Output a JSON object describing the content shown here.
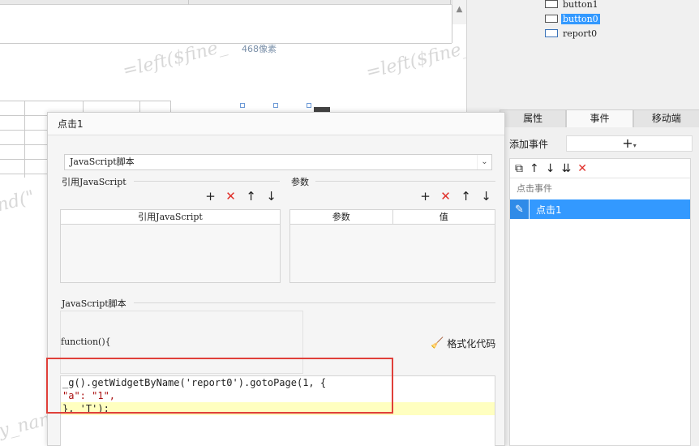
{
  "canvas": {
    "pixel_label": "468像素",
    "watermarks": [
      "=left($fine_",
      "=left($fine_",
      "nd(\"",
      "y_nan"
    ]
  },
  "widget_tree": {
    "items": [
      {
        "label": "button1",
        "selected": false
      },
      {
        "label": "button0",
        "selected": true
      },
      {
        "label": "report0",
        "selected": false
      }
    ]
  },
  "right_tabs": [
    {
      "label": "属性",
      "active": false
    },
    {
      "label": "事件",
      "active": true
    },
    {
      "label": "移动端",
      "active": false
    }
  ],
  "events": {
    "add_label": "添加事件",
    "add_plus": "+",
    "add_arrow": "▾",
    "tool_icons": [
      "⧉",
      "↑",
      "↓",
      "⇊",
      "✕"
    ],
    "group_label": "点击事件",
    "item_label": "点击1",
    "item_icon": "✎"
  },
  "dialog": {
    "title": "点击1",
    "type_value": "JavaScript脚本",
    "type_arrow": "⌄",
    "ref_js_label": "引用JavaScript",
    "ref_js_column": "引用JavaScript",
    "params_label": "参数",
    "params_columns": [
      "参数",
      "值"
    ],
    "tool_icons": [
      "+",
      "✕",
      "↑",
      "↓"
    ],
    "script_label": "JavaScript脚本",
    "function_signature": "function(){",
    "format_icon": "🧹",
    "format_label": "格式化代码",
    "code_lines": [
      "_g().getWidgetByName('report0').gotoPage(1, {",
      "\"a\": \"1\",",
      "}, 'T');"
    ]
  },
  "colors": {
    "accent": "#3399ff",
    "highlight_line": "#ffffc0",
    "annotation_box": "#e0403a",
    "delete_icon": "#e0302a"
  }
}
